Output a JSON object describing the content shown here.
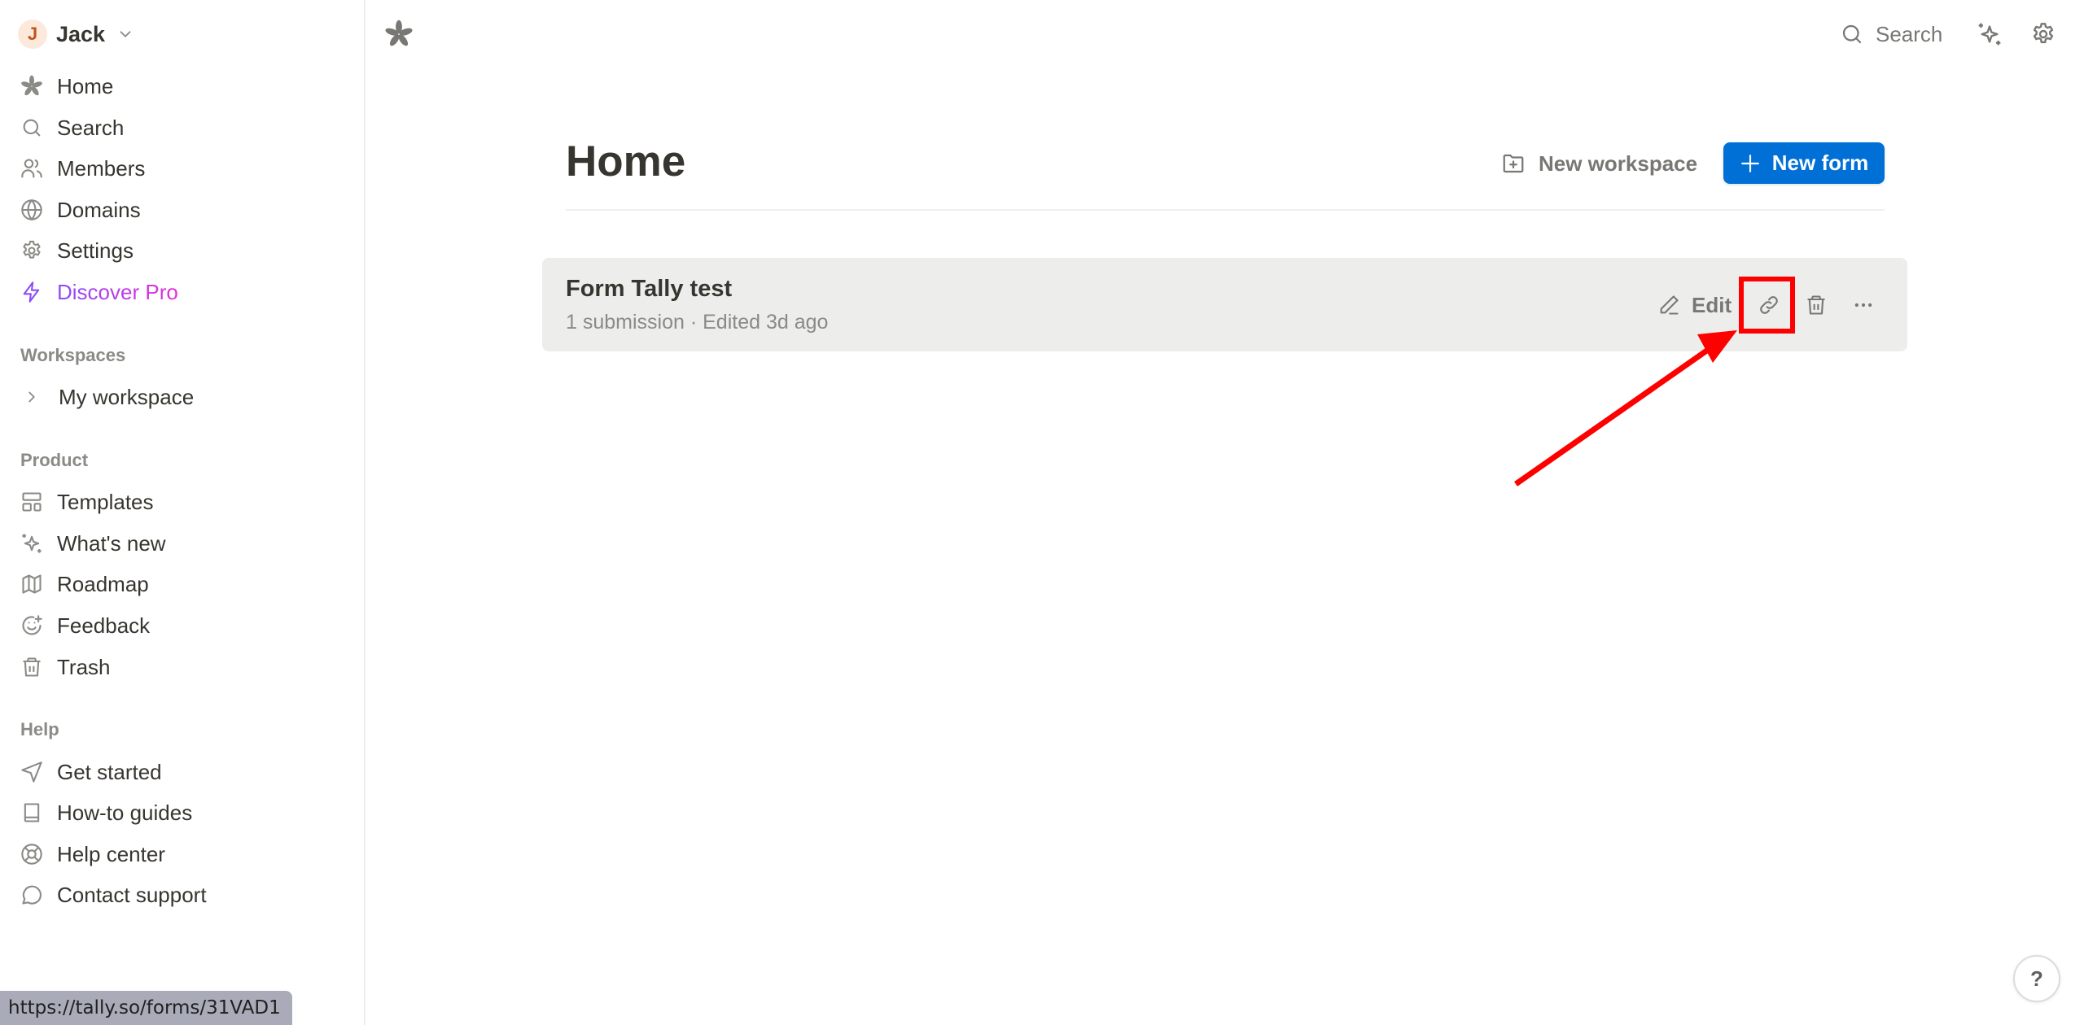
{
  "user": {
    "initial": "J",
    "name": "Jack"
  },
  "sidebar": {
    "main_items": [
      {
        "label": "Home",
        "icon": "asterisk-icon"
      },
      {
        "label": "Search",
        "icon": "search-icon"
      },
      {
        "label": "Members",
        "icon": "users-icon"
      },
      {
        "label": "Domains",
        "icon": "globe-icon"
      },
      {
        "label": "Settings",
        "icon": "gear-icon"
      },
      {
        "label": "Discover Pro",
        "icon": "lightning-icon"
      }
    ],
    "workspaces_label": "Workspaces",
    "workspaces": [
      {
        "label": "My workspace"
      }
    ],
    "product_label": "Product",
    "product_items": [
      {
        "label": "Templates",
        "icon": "templates-icon"
      },
      {
        "label": "What's new",
        "icon": "sparkles-icon"
      },
      {
        "label": "Roadmap",
        "icon": "map-icon"
      },
      {
        "label": "Feedback",
        "icon": "smile-plus-icon"
      },
      {
        "label": "Trash",
        "icon": "trash-icon"
      }
    ],
    "help_label": "Help",
    "help_items": [
      {
        "label": "Get started",
        "icon": "send-icon"
      },
      {
        "label": "How-to guides",
        "icon": "book-icon"
      },
      {
        "label": "Help center",
        "icon": "lifebuoy-icon"
      },
      {
        "label": "Contact support",
        "icon": "chat-icon"
      }
    ]
  },
  "topbar": {
    "search_label": "Search"
  },
  "main": {
    "title": "Home",
    "new_workspace_label": "New workspace",
    "new_form_label": "New form",
    "forms": [
      {
        "title": "Form Tally test",
        "meta": "1 submission · Edited 3d ago",
        "edit_label": "Edit"
      }
    ]
  },
  "status_url": "https://tally.so/forms/31VAD1",
  "help_button": "?",
  "colors": {
    "primary": "#0070d7",
    "annotation": "#ff0000",
    "pro_gradient_start": "#8a4dfa",
    "pro_gradient_end": "#e62ed6"
  }
}
